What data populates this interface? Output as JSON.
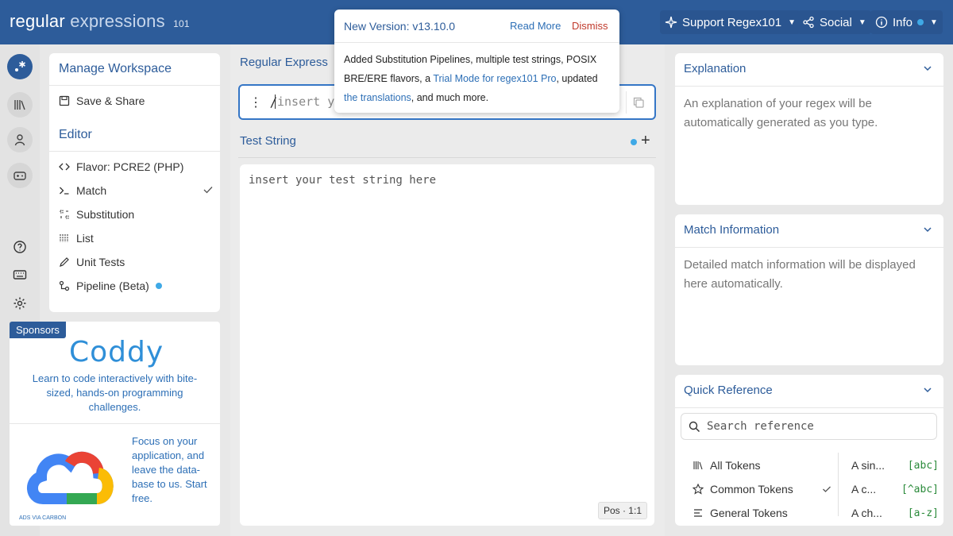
{
  "header": {
    "logo_main": "regular",
    "logo_light": "expressions",
    "logo_sub": "101",
    "support_label": "Support Regex101",
    "social_label": "Social",
    "info_label": "Info"
  },
  "popup": {
    "title": "New Version: v13.10.0",
    "read_more": "Read More",
    "dismiss": "Dismiss",
    "body_1": "Added Substitution Pipelines, multiple test strings, POSIX BRE/ERE flavors, a ",
    "link_1": "Trial Mode for regex101 Pro",
    "body_2": ", updated ",
    "link_2": "the translations",
    "body_3": ", and much more."
  },
  "workspace": {
    "title": "Manage Workspace",
    "save_share": "Save & Share",
    "editor_title": "Editor",
    "flavor_label": "Flavor: PCRE2 (PHP)",
    "items": [
      {
        "label": "Match",
        "checked": true
      },
      {
        "label": "Substitution"
      },
      {
        "label": "List"
      },
      {
        "label": "Unit Tests"
      },
      {
        "label": "Pipeline (Beta)",
        "dot": true
      }
    ]
  },
  "sponsors": {
    "tag": "Sponsors",
    "coddy_logo": "Coddy",
    "coddy_text": "Learn to code interactively with bite-sized, hands-on programming challenges.",
    "gc_text": "Focus on your application, and leave the data-base to us. Start free.",
    "ads": "ADS VIA CARBON"
  },
  "regex": {
    "section_title": "Regular Express",
    "delimiter": "/",
    "placeholder": "insert yo"
  },
  "test_string": {
    "title": "Test String",
    "placeholder": "insert your test string here",
    "pos": "Pos · 1:1"
  },
  "explanation": {
    "title": "Explanation",
    "body": "An explanation of your regex will be automatically generated as you type."
  },
  "match_info": {
    "title": "Match Information",
    "body": "Detailed match information will be displayed here automatically."
  },
  "quick_reference": {
    "title": "Quick Reference",
    "search_placeholder": "Search reference",
    "categories": [
      {
        "label": "All Tokens"
      },
      {
        "label": "Common Tokens",
        "checked": true
      },
      {
        "label": "General Tokens"
      }
    ],
    "tokens": [
      {
        "desc": "A sin...",
        "code": "[abc]"
      },
      {
        "desc": "A c...",
        "code": "[^abc]"
      },
      {
        "desc": "A ch...",
        "code": "[a-z]"
      }
    ]
  },
  "colors": {
    "brand": "#2d5c9a",
    "accent": "#3fa9e6",
    "link": "#2d6fb6",
    "danger": "#c0392b"
  }
}
